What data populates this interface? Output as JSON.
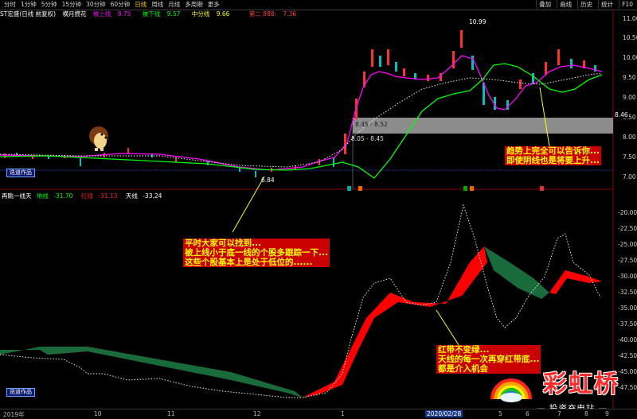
{
  "topbar": {
    "tabs": [
      "分时",
      "1分钟",
      "5分钟",
      "15分钟",
      "30分钟",
      "60分钟",
      "日线",
      "周线",
      "月线",
      "多周期",
      "更多"
    ],
    "active_tab": "日线",
    "tools": [
      "叠加",
      "画线",
      "历史",
      "统计",
      "F10"
    ]
  },
  "upper_legend": {
    "stock": "ST宏盛(日线 前复权)",
    "indicator": "横月攒花",
    "lines": [
      {
        "label": "被上线",
        "value": "9.75",
        "color": "#ff00ff"
      },
      {
        "label": "被下线",
        "value": "9.57",
        "color": "#00ff00"
      },
      {
        "label": "中分线",
        "value": "9.66",
        "color": "#ffff00"
      },
      {
        "label": "第二 888:",
        "value": "7.36",
        "color": "#ff4040"
      }
    ]
  },
  "lower_legend": {
    "name": "再眺一线天",
    "lines": [
      {
        "label": "地线",
        "value": "-31.70",
        "color": "#00ff00"
      },
      {
        "label": "红线",
        "value": "-31.13",
        "color": "#ff2020"
      },
      {
        "label": "天线",
        "value": "-33.24",
        "color": "#ffffff"
      }
    ]
  },
  "price_labels": {
    "high": "10.99",
    "low": "6.84",
    "box_top": "8.45 - 8.52",
    "box_bottom": "8.05 - 8.45",
    "current": "8.46"
  },
  "upper_axis": [
    "11.00",
    "10.50",
    "10.00",
    "9.50",
    "9.00",
    "8.50",
    "8.00",
    "7.50",
    "7.00"
  ],
  "lower_axis": [
    "-20.00",
    "-22.50",
    "-25.00",
    "-27.50",
    "-30.00",
    "-32.50",
    "-35.00",
    "-37.50",
    "-40.00",
    "-42.50",
    "-45.00",
    "-47.50"
  ],
  "badges": {
    "upper": "迭道作品",
    "lower": "迭道作品"
  },
  "annotations": {
    "trend": [
      "趋势上完全可以告诉你...",
      "即使阴线也是将要上升..."
    ],
    "low": [
      "平时大家可以找到...",
      "被上线小于底一线的个股多跟踪一下...",
      "这些个股基本上是处于低位的......"
    ],
    "red": [
      "红带不变绿...",
      "天线的每一次再穿红带底...",
      "都是介入机会"
    ]
  },
  "bottom_dates": [
    "2019年",
    "10",
    "11",
    "12",
    "1",
    "2020/02/28",
    "5",
    "6",
    "7",
    "8",
    "9"
  ],
  "logo": {
    "brand": "彩虹桥",
    "slogan": "— 投资充电站 —"
  }
}
